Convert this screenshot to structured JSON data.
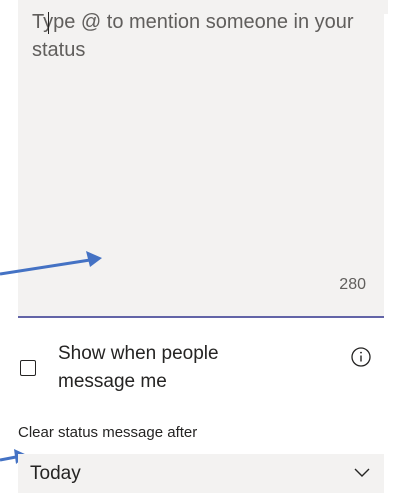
{
  "status_message": {
    "value": "",
    "placeholder": "Type @ to mention someone in your status",
    "char_count": "280"
  },
  "show_when_messaged": {
    "label": "Show when people message me",
    "checked": false
  },
  "clear_after": {
    "label": "Clear status message after",
    "selected": "Today"
  },
  "colors": {
    "accent": "#6264a7",
    "arrow": "#4472c4",
    "field_bg": "#f3f2f1"
  },
  "icons": {
    "info": "info-icon",
    "chevron": "chevron-down-icon"
  }
}
